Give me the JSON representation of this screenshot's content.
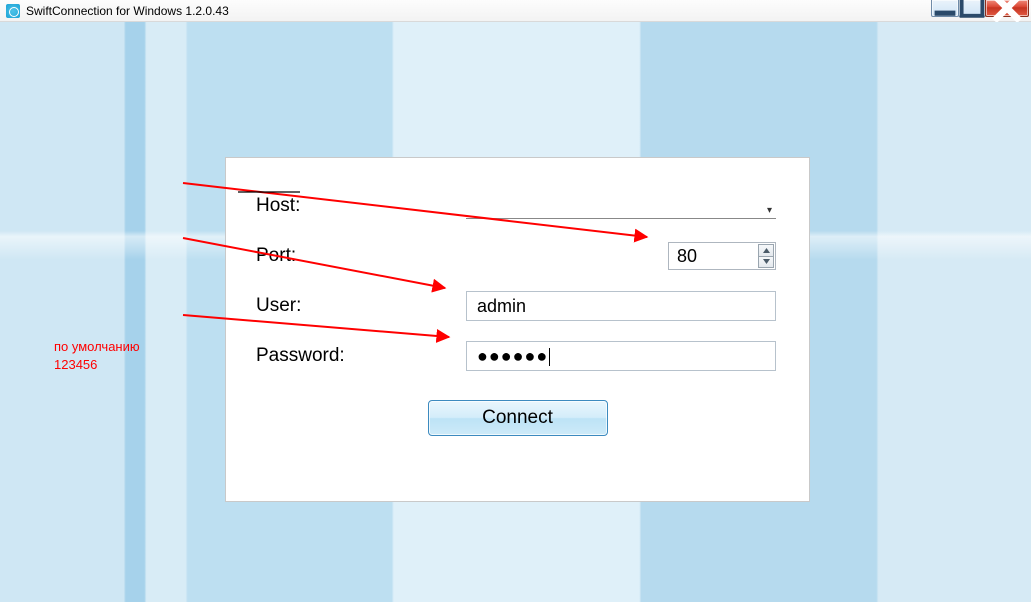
{
  "window": {
    "title": "SwiftConnection for Windows 1.2.0.43"
  },
  "form": {
    "host_label": "Host:",
    "host_value": "",
    "port_label": "Port:",
    "port_value": "80",
    "user_label": "User:",
    "user_value": "admin",
    "password_label": "Password:",
    "password_masked": "●●●●●●",
    "connect_label": "Connect"
  },
  "annotation": {
    "line1": "по умолчанию",
    "line2": "123456"
  }
}
